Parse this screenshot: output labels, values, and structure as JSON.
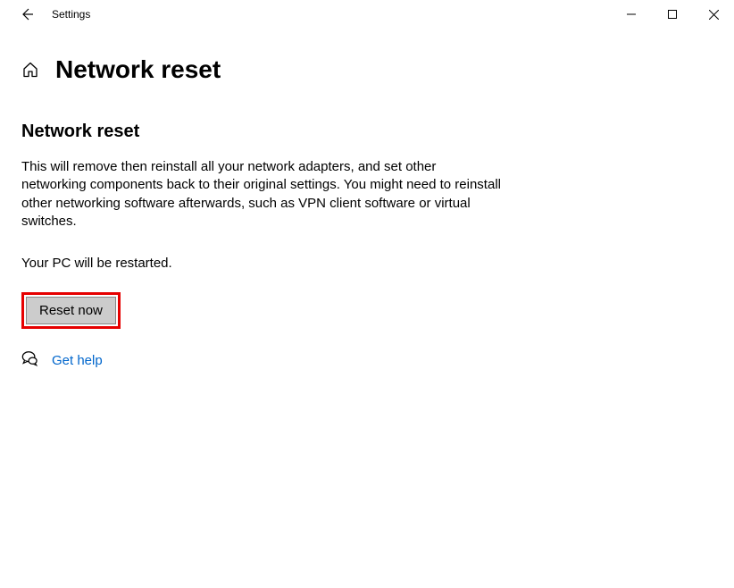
{
  "titlebar": {
    "app_name": "Settings"
  },
  "header": {
    "title": "Network reset"
  },
  "main": {
    "section_title": "Network reset",
    "description": "This will remove then reinstall all your network adapters, and set other networking components back to their original settings. You might need to reinstall other networking software afterwards, such as VPN client software or virtual switches.",
    "restart_note": "Your PC will be restarted.",
    "reset_button": "Reset now",
    "help_link": "Get help"
  },
  "highlight": {
    "color": "#e60000"
  }
}
